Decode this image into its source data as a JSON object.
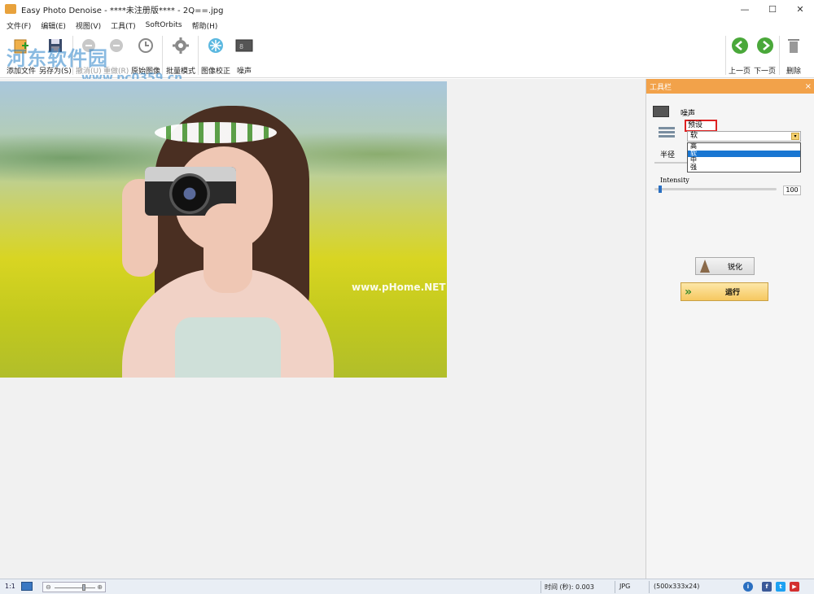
{
  "window": {
    "title": "Easy Photo Denoise - ****未注册版**** - 2Q==.jpg",
    "minimize": "—",
    "maximize": "☐",
    "close": "✕"
  },
  "watermark": {
    "line1": "河东软件园",
    "line2": "www.pc0359.cn"
  },
  "menu": [
    "文件(F)",
    "编辑(E)",
    "视图(V)",
    "工具(T)",
    "SoftOrbits",
    "帮助(H)"
  ],
  "toolbar": {
    "add_file": "添加文件",
    "save_as": "另存为(S)",
    "undo": "撤消(U)",
    "redo": "重做(R)",
    "original": "原始图像",
    "batch": "批量模式",
    "correction": "图像校正",
    "noise": "噪声",
    "prev": "上一页",
    "next": "下一页",
    "delete": "删除"
  },
  "photo": {
    "watermark": "www.pHome.NET"
  },
  "panel": {
    "title": "工具栏",
    "close": "×",
    "noise_label": "噪声",
    "preset_label": "预设",
    "preset_value": "软",
    "dropdown_options": [
      "高",
      "软",
      "中",
      "强"
    ],
    "dropdown_selected_index": 1,
    "radius_label": "半径",
    "intensity_label": "Intensity",
    "intensity_value": "100",
    "intensity_fraction": 0.03,
    "sharpen_button": "锐化",
    "run_button": "运行"
  },
  "status": {
    "ratio": "1:1",
    "time": "时间 (秒): 0.003",
    "format": "JPG",
    "dimensions": "(500x333x24)"
  },
  "colors": {
    "panel_header": "#f2a24a",
    "run_button": "#f6c860",
    "accent_blue": "#1976d2"
  }
}
